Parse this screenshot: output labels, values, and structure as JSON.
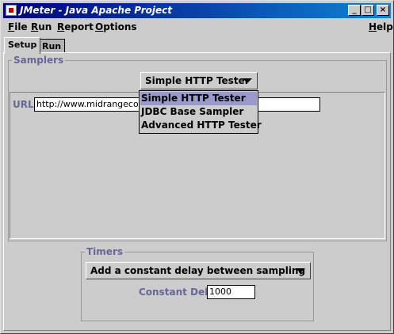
{
  "window": {
    "title": "JMeter - Java Apache Project",
    "controls": {
      "minimize": "_",
      "maximize": "□",
      "close": "×"
    }
  },
  "menu": {
    "file": {
      "first": "F",
      "rest": "ile"
    },
    "run": {
      "first": "R",
      "rest": "un"
    },
    "report": {
      "first": "R",
      "rest": "eport"
    },
    "options": {
      "first": "O",
      "rest": "ptions"
    },
    "help": {
      "first": "H",
      "rest": "elp"
    }
  },
  "tabs": [
    {
      "label": "Setup",
      "active": true
    },
    {
      "label": "Run",
      "active": false
    }
  ],
  "samplers": {
    "title": "Samplers",
    "selected": "Simple HTTP Tester",
    "options": [
      "Simple HTTP Tester",
      "JDBC Base Sampler",
      "Advanced HTTP Tester"
    ],
    "url_label": "URL",
    "url_value": "http://www.midrangecom"
  },
  "timers": {
    "title": "Timers",
    "selected": "Add a constant delay between sampling",
    "delay_label": "Constant Delay",
    "delay_value": "1000"
  }
}
